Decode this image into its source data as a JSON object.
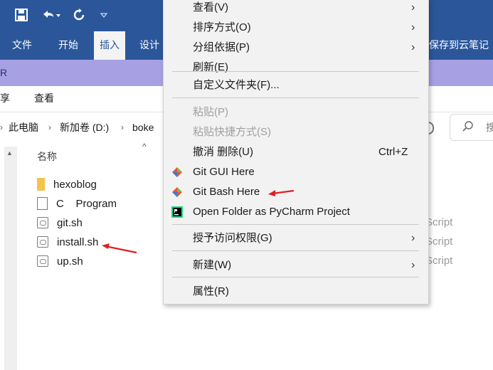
{
  "word": {
    "tabs": [
      "文件",
      "开始",
      "插入",
      "设计"
    ],
    "active_tab": "插入",
    "right_label": "保存到云笔记",
    "band_text": "R"
  },
  "explorer": {
    "ribbon_tabs": [
      "享",
      "查看"
    ],
    "breadcrumb": [
      "此电脑",
      "新加卷 (D:)",
      "boke"
    ],
    "column_name": "名称",
    "search_glyph": "搜",
    "files": [
      {
        "name": "hexoblog",
        "icon": "folder-icon",
        "type": ""
      },
      {
        "name": "C    Program",
        "icon": "document-icon",
        "type": ""
      },
      {
        "name": "git.sh",
        "icon": "shell-script-icon",
        "type": "Script"
      },
      {
        "name": "install.sh",
        "icon": "shell-script-icon",
        "type": "Script"
      },
      {
        "name": "up.sh",
        "icon": "shell-script-icon",
        "type": "Script"
      }
    ]
  },
  "context_menu": {
    "view": "查看(V)",
    "sort": "排序方式(O)",
    "group": "分组依据(P)",
    "refresh": "刷新(E)",
    "customize": "自定义文件夹(F)...",
    "paste": "粘贴(P)",
    "paste_shortcut": "粘贴快捷方式(S)",
    "undo": "撤消 删除(U)",
    "undo_shortcut": "Ctrl+Z",
    "git_gui": "Git GUI Here",
    "git_bash": "Git Bash Here",
    "pycharm": "Open Folder as PyCharm Project",
    "grant_access": "授予访问权限(G)",
    "new": "新建(W)",
    "properties": "属性(R)"
  },
  "colors": {
    "ribbon_blue": "#2b579a",
    "purple_band": "#a7a1e4",
    "menu_bg": "#f2f2f2",
    "annotation_red": "#e02020"
  }
}
